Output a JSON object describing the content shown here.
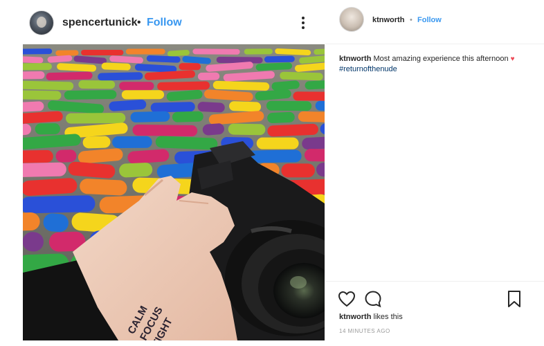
{
  "post": {
    "author": "spencertunick",
    "separator": "•",
    "follow_label": "Follow",
    "more_icon": "more-options-icon",
    "photo": {
      "hand_text_lines": [
        "CALM",
        "FOCUS",
        "TIGHT"
      ]
    }
  },
  "panel": {
    "author": "ktnworth",
    "separator": "•",
    "follow_label": "Follow",
    "caption": {
      "user": "ktnworth",
      "text": "Most amazing experience this afternoon",
      "emoji": "♥",
      "hashtag": "#returnofthenude"
    },
    "actions": {
      "like_icon": "heart-icon",
      "comment_icon": "comment-icon",
      "save_icon": "bookmark-icon"
    },
    "likes": {
      "user": "ktnworth",
      "suffix": "likes this"
    },
    "timestamp": "14 MINUTES AGO"
  },
  "colors": {
    "link_blue": "#3897f0",
    "text": "#262626",
    "muted": "#999999",
    "heart_red": "#ed4956",
    "hashtag": "#003569"
  }
}
